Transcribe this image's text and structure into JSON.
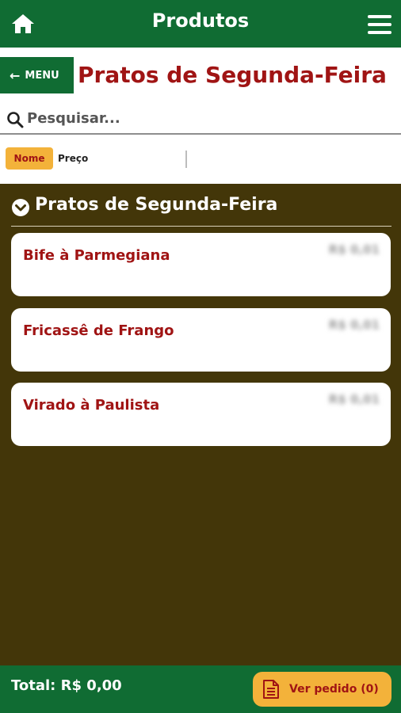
{
  "header": {
    "title": "Produtos",
    "home_icon": "home-icon",
    "menu_icon": "hamburger-icon"
  },
  "nav": {
    "menu_label": "MENU",
    "menu_arrow": "←",
    "page_title": "Pratos de Segunda-Feira"
  },
  "search": {
    "placeholder": "Pesquisar...",
    "value": ""
  },
  "sort": {
    "options": [
      {
        "label": "Nome",
        "active": true
      },
      {
        "label": "Preço",
        "active": false
      }
    ]
  },
  "section": {
    "title": "Pratos de Segunda-Feira",
    "items": [
      {
        "name": "Bife à Parmegiana",
        "price": "R$ 0,01"
      },
      {
        "name": "Fricassê de Frango",
        "price": "R$ 0,01"
      },
      {
        "name": "Virado à Paulista",
        "price": "R$ 0,01"
      }
    ]
  },
  "footer": {
    "total_label": "Total: R$ 0,00",
    "ver_pedido_label": "Ver pedido (0)"
  },
  "colors": {
    "brand_green": "#106c33",
    "accent_orange": "#f3b23a",
    "title_red": "#a01414",
    "content_bg": "#433609"
  }
}
